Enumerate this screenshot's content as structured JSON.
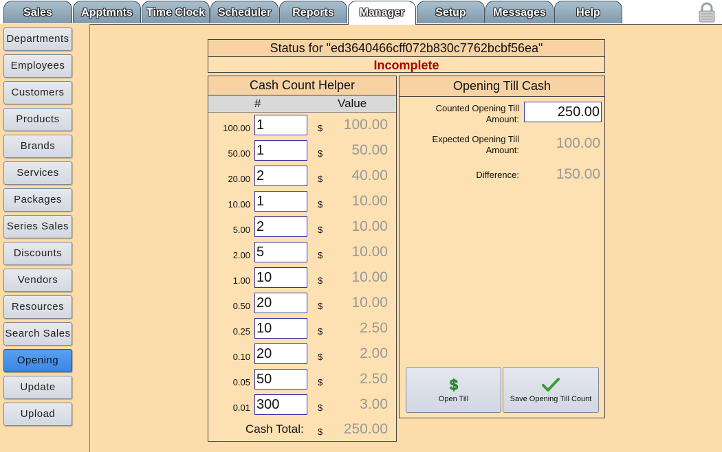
{
  "tabs": [
    {
      "label": "Sales",
      "active": false
    },
    {
      "label": "Apptmnts",
      "active": false
    },
    {
      "label": "Time Clock",
      "active": false
    },
    {
      "label": "Scheduler",
      "active": false
    },
    {
      "label": "Reports",
      "active": false
    },
    {
      "label": "Manager",
      "active": true
    },
    {
      "label": "Setup",
      "active": false
    },
    {
      "label": "Messages",
      "active": false
    },
    {
      "label": "Help",
      "active": false
    }
  ],
  "lock_icon": "lock-icon",
  "sidebar": {
    "items": [
      {
        "label": "Departments"
      },
      {
        "label": "Employees"
      },
      {
        "label": "Customers"
      },
      {
        "label": "Products"
      },
      {
        "label": "Brands"
      },
      {
        "label": "Services"
      },
      {
        "label": "Packages"
      },
      {
        "label": "Series Sales"
      },
      {
        "label": "Discounts"
      },
      {
        "label": "Vendors"
      },
      {
        "label": "Resources"
      },
      {
        "label": "Search Sales"
      },
      {
        "label": "Opening",
        "active": true
      },
      {
        "label": "Update"
      },
      {
        "label": "Upload"
      }
    ]
  },
  "status": {
    "title": "Status for \"ed3640466cff072b830c7762bcbf56ea\"",
    "value": "Incomplete",
    "value_color": "#b00000"
  },
  "cash_helper": {
    "title": "Cash Count Helper",
    "col_num": "#",
    "col_value": "Value",
    "currency": "$",
    "rows": [
      {
        "denomination": "100.00",
        "count": "1",
        "value": "100.00"
      },
      {
        "denomination": "50.00",
        "count": "1",
        "value": "50.00"
      },
      {
        "denomination": "20.00",
        "count": "2",
        "value": "40.00"
      },
      {
        "denomination": "10.00",
        "count": "1",
        "value": "10.00"
      },
      {
        "denomination": "5.00",
        "count": "2",
        "value": "10.00"
      },
      {
        "denomination": "2.00",
        "count": "5",
        "value": "10.00"
      },
      {
        "denomination": "1.00",
        "count": "10",
        "value": "10.00"
      },
      {
        "denomination": "0.50",
        "count": "20",
        "value": "10.00"
      },
      {
        "denomination": "0.25",
        "count": "10",
        "value": "2.50"
      },
      {
        "denomination": "0.10",
        "count": "20",
        "value": "2.00"
      },
      {
        "denomination": "0.05",
        "count": "50",
        "value": "2.50"
      },
      {
        "denomination": "0.01",
        "count": "300",
        "value": "3.00"
      }
    ],
    "total_label": "Cash Total:",
    "total_value": "250.00"
  },
  "opening_till": {
    "title": "Opening Till Cash",
    "counted_label": "Counted Opening Till Amount:",
    "counted_value": "250.00",
    "expected_label": "Expected Opening Till Amount:",
    "expected_value": "100.00",
    "difference_label": "Difference:",
    "difference_value": "150.00",
    "open_till_label": "Open Till",
    "open_till_icon": "dollar-icon",
    "save_label": "Save Opening Till Count",
    "save_icon": "checkmark-icon"
  },
  "colors": {
    "background": "#fbdcaa",
    "active_sidebar": "#3a86e6",
    "tab": "#8ea8b8"
  }
}
